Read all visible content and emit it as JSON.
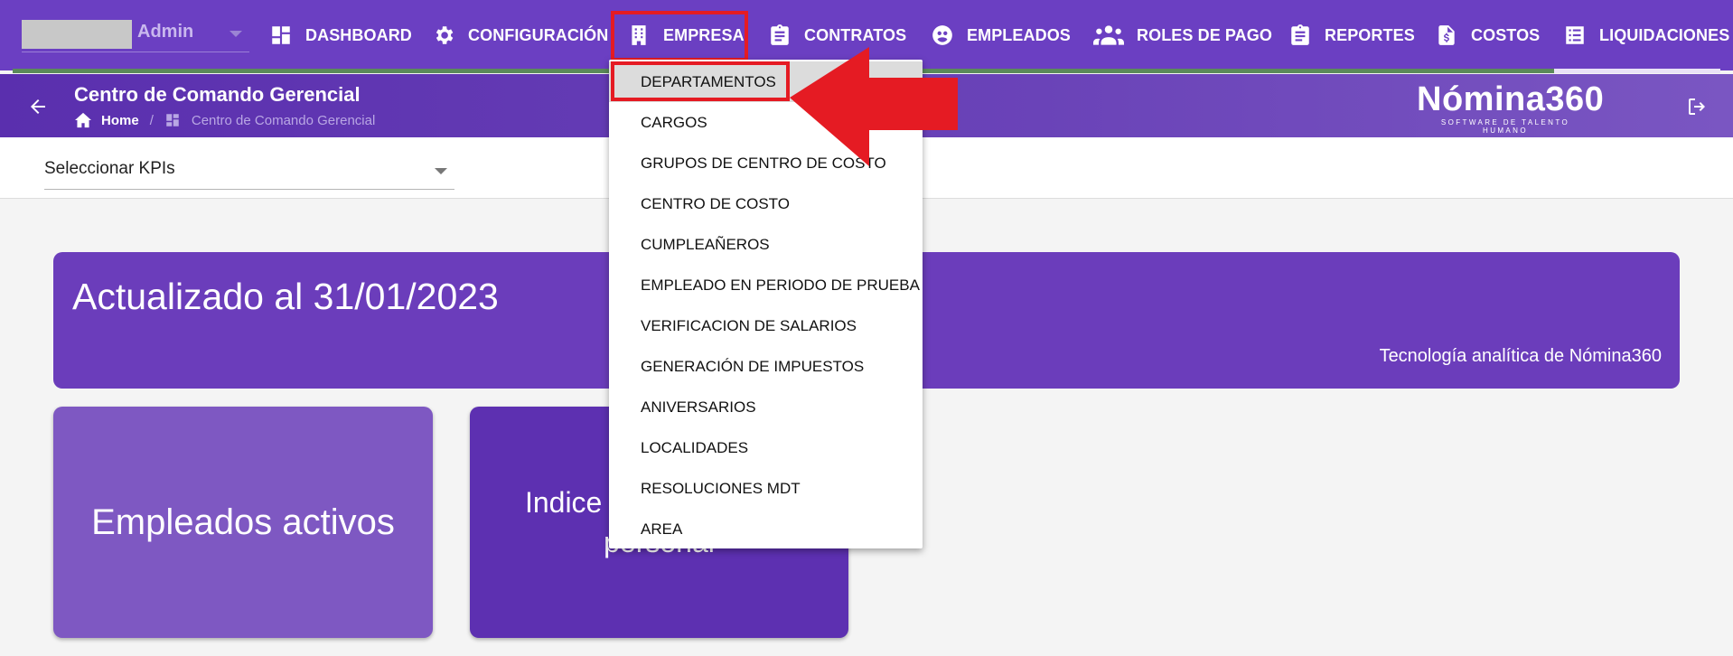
{
  "topbar": {
    "user": {
      "name": "Admin"
    },
    "nav": [
      {
        "id": "dashboard",
        "label": "DASHBOARD",
        "icon": "dashboard-icon"
      },
      {
        "id": "configuracion",
        "label": "CONFIGURACIÓN",
        "icon": "gear-icon"
      },
      {
        "id": "empresa",
        "label": "EMPRESA",
        "icon": "building-icon"
      },
      {
        "id": "contratos",
        "label": "CONTRATOS",
        "icon": "clipboard-icon"
      },
      {
        "id": "empleados",
        "label": "EMPLEADOS",
        "icon": "employee-icon"
      },
      {
        "id": "roles",
        "label": "ROLES DE PAGO",
        "icon": "people-icon"
      },
      {
        "id": "reportes",
        "label": "REPORTES",
        "icon": "clipboard-icon"
      },
      {
        "id": "costos",
        "label": "COSTOS",
        "icon": "dollar-file-icon"
      },
      {
        "id": "liquidaciones",
        "label": "LIQUIDACIONES",
        "icon": "list-icon"
      }
    ]
  },
  "header": {
    "title": "Centro de Comando Gerencial",
    "breadcrumb": {
      "home": "Home",
      "current": "Centro de Comando Gerencial"
    },
    "brand": {
      "name": "Nómina360",
      "tagline": "SOFTWARE DE TALENTO HUMANO"
    }
  },
  "kpi_select": {
    "label": "Seleccionar KPIs"
  },
  "update_card": {
    "title": "Actualizado al 31/01/2023",
    "subtitle": "Tecnología analítica de Nómina360"
  },
  "cards": [
    {
      "label": "Empleados activos"
    },
    {
      "label": "Indice de rotación de personal"
    }
  ],
  "empresa_menu": {
    "items": [
      {
        "label": "DEPARTAMENTOS",
        "active": true
      },
      {
        "label": "CARGOS"
      },
      {
        "label": "GRUPOS DE CENTRO DE COSTO"
      },
      {
        "label": "CENTRO DE COSTO"
      },
      {
        "label": "CUMPLEAÑEROS"
      },
      {
        "label": "EMPLEADO EN PERIODO DE PRUEBA"
      },
      {
        "label": "VERIFICACION DE SALARIOS"
      },
      {
        "label": "GENERACIÓN DE IMPUESTOS"
      },
      {
        "label": "ANIVERSARIOS"
      },
      {
        "label": "LOCALIDADES"
      },
      {
        "label": "RESOLUCIONES MDT"
      },
      {
        "label": "AREA"
      }
    ]
  },
  "colors": {
    "primary": "#6b3fc2",
    "annotation": "#e51b23"
  }
}
